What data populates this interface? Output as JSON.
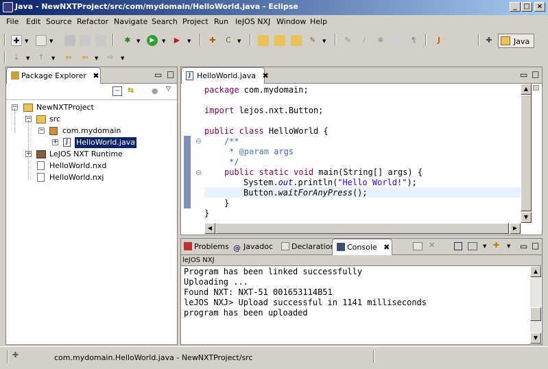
{
  "window": {
    "title": "Java - NewNXTProject/src/com/mydomain/HelloWorld.java - Eclipse",
    "min": "_",
    "max": "□",
    "close": "×"
  },
  "menu": [
    "File",
    "Edit",
    "Source",
    "Refactor",
    "Navigate",
    "Search",
    "Project",
    "Run",
    "leJOS NXJ",
    "Window",
    "Help"
  ],
  "perspective": {
    "label": "Java"
  },
  "package_explorer": {
    "tab_label": "Package Explorer",
    "tree": [
      {
        "label": "NewNXTProject",
        "depth": 0,
        "expander": "−",
        "icon": "project-icon"
      },
      {
        "label": "src",
        "depth": 1,
        "expander": "−",
        "icon": "source-folder-icon"
      },
      {
        "label": "com.mydomain",
        "depth": 2,
        "expander": "−",
        "icon": "package-icon"
      },
      {
        "label": "HelloWorld.java",
        "depth": 3,
        "expander": "+",
        "icon": "java-file-icon",
        "selected": true
      },
      {
        "label": "LeJOS NXT Runtime",
        "depth": 1,
        "expander": "+",
        "icon": "library-icon"
      },
      {
        "label": "HelloWorld.nxd",
        "depth": 1,
        "expander": "",
        "icon": "file-icon"
      },
      {
        "label": "HelloWorld.nxj",
        "depth": 1,
        "expander": "",
        "icon": "file-icon"
      }
    ]
  },
  "editor": {
    "tab_label": "HelloWorld.java",
    "code": {
      "l1_kw": "package",
      "l1_rest": " com.mydomain;",
      "l2_kw": "import",
      "l2_rest": " lejos.nxt.Button;",
      "l3_kw": "public class",
      "l3_rest": " HelloWorld {",
      "l4": "    /**",
      "l5_a": "     * ",
      "l5_tag": "@param",
      "l5_b": " args",
      "l6": "     */",
      "l7_kw1": "public static void",
      "l7_rest": " main(String[] args) {",
      "l8_a": "System.",
      "l8_field": "out",
      "l8_b": ".println(",
      "l8_str": "\"Hello World!\"",
      "l8_c": ");",
      "l9_a": "Button.",
      "l9_m": "waitForAnyPress",
      "l9_b": "();",
      "l10": "}",
      "l11": "}"
    }
  },
  "bottom_tabs": {
    "problems": "Problems",
    "javadoc": "Javadoc",
    "declaration": "Declaration",
    "console": "Console"
  },
  "console": {
    "name": "leJOS NXJ",
    "lines": [
      "Program has been linked successfully",
      "Uploading ...",
      "Found NXT: NXT-51 001653114B51",
      "leJOS NXJ> Upload successful in 1141 milliseconds",
      "program has been uploaded"
    ]
  },
  "status": {
    "text": "com.mydomain.HelloWorld.java - NewNXTProject/src"
  }
}
